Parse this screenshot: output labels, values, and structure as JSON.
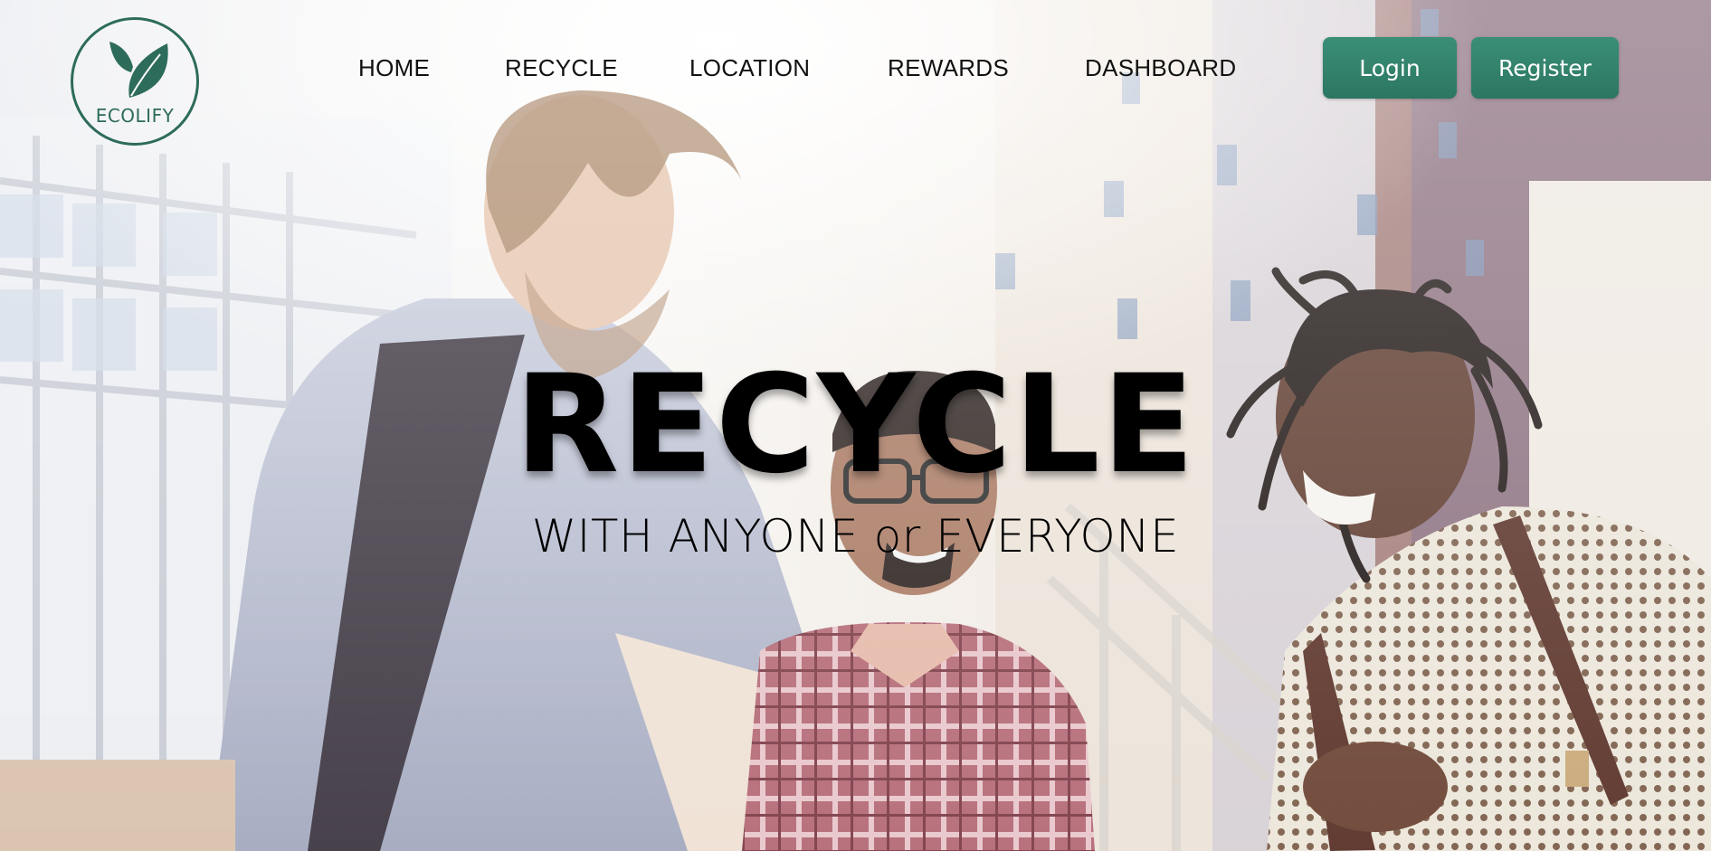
{
  "brand": {
    "name": "ECOLIFY",
    "logo_icon": "leaf-icon",
    "color": "#2d6b5a"
  },
  "nav": {
    "items": [
      {
        "label": "HOME"
      },
      {
        "label": "RECYCLE"
      },
      {
        "label": "LOCATION"
      },
      {
        "label": "REWARDS"
      },
      {
        "label": "DASHBOARD"
      }
    ]
  },
  "auth": {
    "login_label": "Login",
    "register_label": "Register",
    "button_color": "#2f7b66"
  },
  "hero": {
    "title": "RECYCLE",
    "subtitle": "WITH ANYONE or EVERYONE",
    "background": "photo-of-three-smiling-people-outdoors"
  }
}
